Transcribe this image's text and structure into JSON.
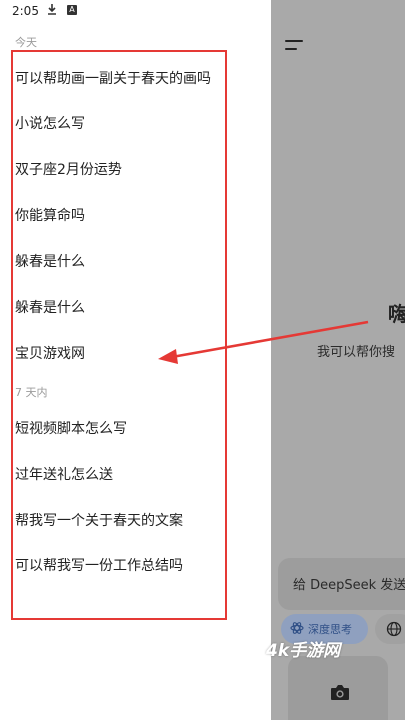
{
  "status_bar": {
    "time": "2:05",
    "download_icon": "download-icon",
    "app_badge_icon": "a-badge-icon",
    "wifi_icon": "wifi-icon",
    "signal_icon": "signal-icon",
    "battery_icon": "battery-icon"
  },
  "drawer": {
    "sections": [
      {
        "label": "今天",
        "items": [
          "可以帮助画一副关于春天的画吗",
          "小说怎么写",
          "双子座2月份运势",
          "你能算命吗",
          "躲春是什么",
          "躲春是什么",
          "宝贝游戏网"
        ]
      },
      {
        "label": "7 天内",
        "items": [
          "短视频脚本怎么写",
          "过年送礼怎么送",
          "帮我写一个关于春天的文案",
          "可以帮我写一份工作总结吗"
        ]
      }
    ],
    "highlight_color": "#e53935"
  },
  "main": {
    "menu_icon": "menu-icon",
    "greeting": "嗨",
    "subtitle": "我可以帮你搜",
    "input_placeholder": "给 DeepSeek 发送",
    "deep_think_label": "深度思考",
    "deep_think_icon": "atom-icon",
    "search_icon": "globe-icon",
    "camera_icon": "camera-icon",
    "watermark": "4k手游网",
    "accent_color": "#2f4f86"
  }
}
